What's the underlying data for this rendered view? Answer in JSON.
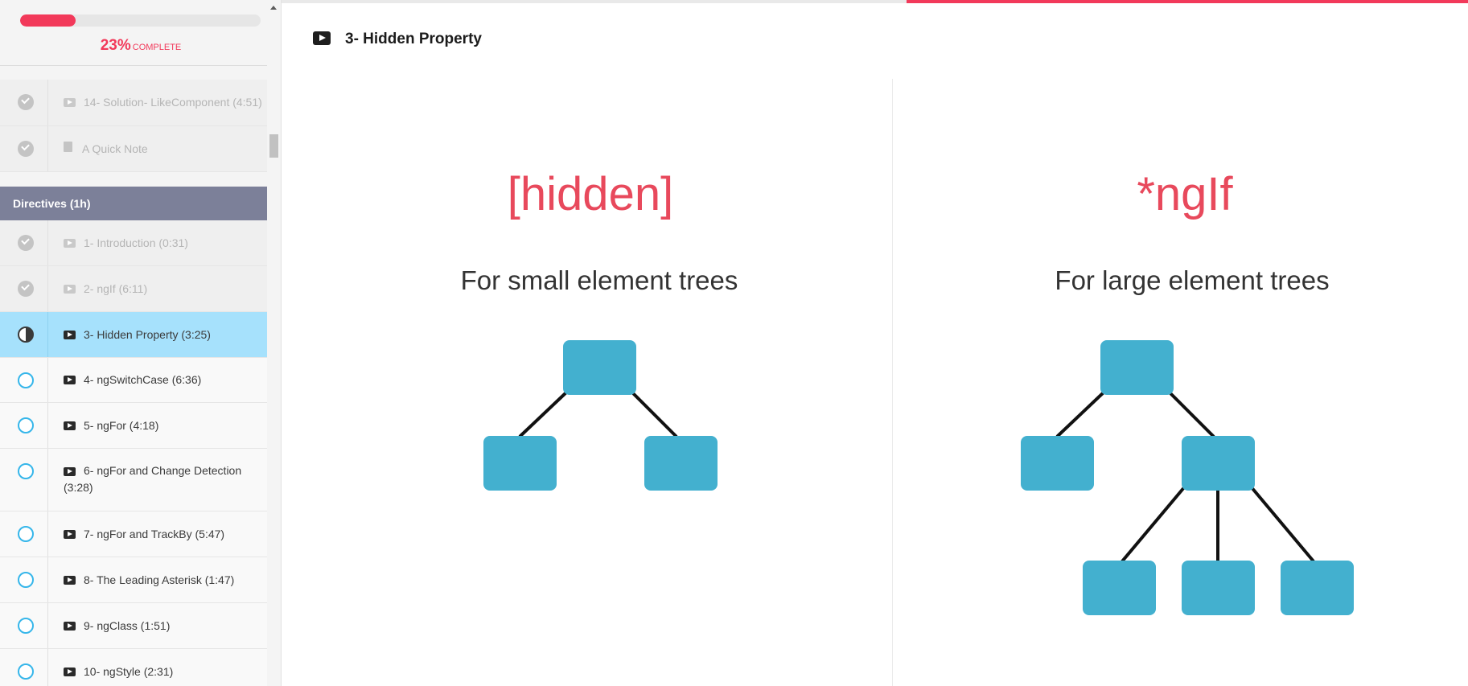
{
  "sidebar": {
    "progress": {
      "percent": 23,
      "percent_text": "23%",
      "label": "COMPLETE"
    },
    "items_top": [
      {
        "title": "14- Solution- LikeComponent (4:51)",
        "icon": "play-icon",
        "status": "completed"
      },
      {
        "title": "A Quick Note",
        "icon": "document-icon",
        "status": "completed"
      }
    ],
    "section": {
      "title": "Directives (1h)"
    },
    "items": [
      {
        "title": "1- Introduction (0:31)",
        "icon": "play-icon",
        "status": "completed"
      },
      {
        "title": "2- ngIf (6:11)",
        "icon": "play-icon",
        "status": "completed"
      },
      {
        "title": "3- Hidden Property (3:25)",
        "icon": "play-icon",
        "status": "in-progress"
      },
      {
        "title": "4- ngSwitchCase (6:36)",
        "icon": "play-icon",
        "status": "not-started"
      },
      {
        "title": "5- ngFor (4:18)",
        "icon": "play-icon",
        "status": "not-started"
      },
      {
        "title": "6- ngFor and Change Detection (3:28)",
        "icon": "play-icon",
        "status": "not-started"
      },
      {
        "title": "7- ngFor and TrackBy (5:47)",
        "icon": "play-icon",
        "status": "not-started"
      },
      {
        "title": "8- The Leading Asterisk (1:47)",
        "icon": "play-icon",
        "status": "not-started"
      },
      {
        "title": "9- ngClass (1:51)",
        "icon": "play-icon",
        "status": "not-started"
      },
      {
        "title": "10- ngStyle (2:31)",
        "icon": "play-icon",
        "status": "not-started"
      }
    ]
  },
  "lecture": {
    "title": "3- Hidden Property",
    "icon": "video-icon"
  },
  "slide": {
    "left": {
      "title": "[hidden]",
      "subtitle": "For small element trees"
    },
    "right": {
      "title": "*ngIf",
      "subtitle": "For large element trees"
    }
  },
  "colors": {
    "accent": "#f2395a",
    "active_row": "#a6e1fc",
    "section_header": "#7c8099",
    "tree_node": "#43b0cf",
    "slide_title": "#e8495c"
  }
}
